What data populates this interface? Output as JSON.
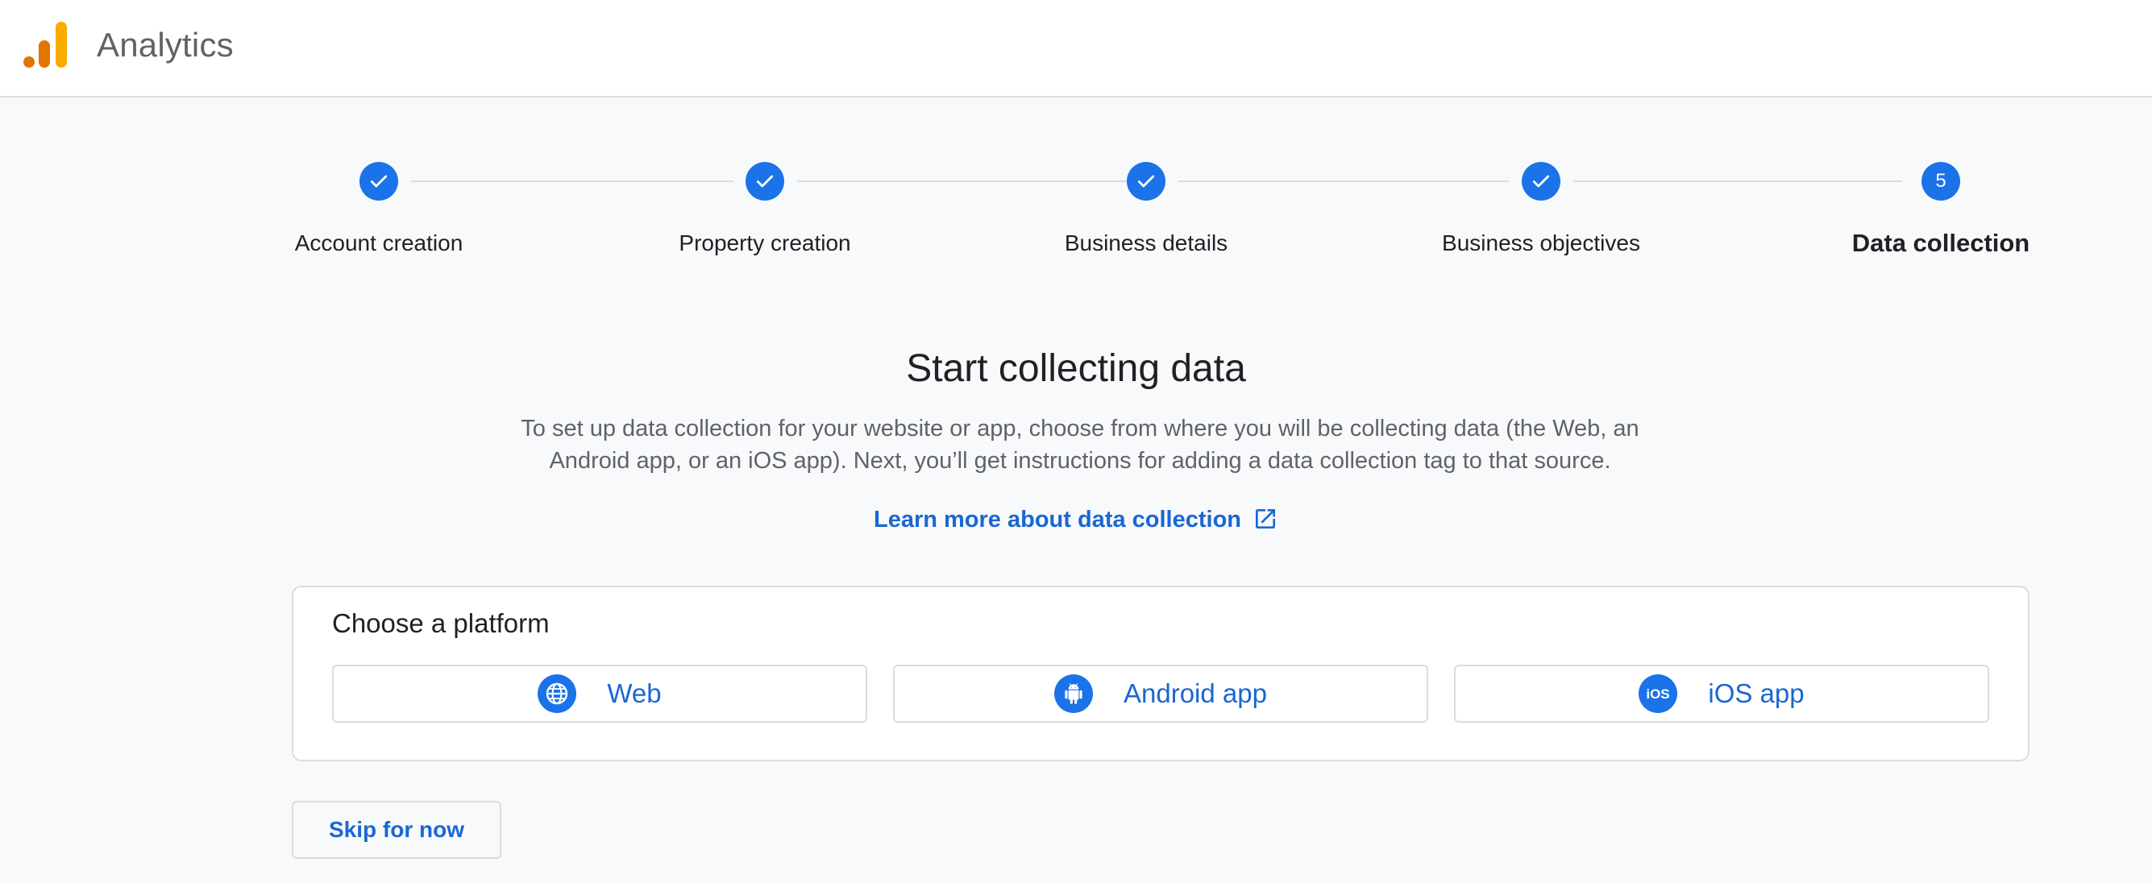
{
  "header": {
    "app_title": "Analytics",
    "logo_colors": [
      "#f9ab00",
      "#e37400"
    ]
  },
  "stepper": {
    "accent_color": "#1a73e8",
    "steps": [
      {
        "label": "Account creation",
        "state": "complete"
      },
      {
        "label": "Property creation",
        "state": "complete"
      },
      {
        "label": "Business details",
        "state": "complete"
      },
      {
        "label": "Business objectives",
        "state": "complete"
      },
      {
        "label": "Data collection",
        "state": "current",
        "number": "5"
      }
    ]
  },
  "main": {
    "heading": "Start collecting data",
    "description": "To set up data collection for your website or app, choose from where you will be collecting data (the Web, an Android app, or an iOS app). Next, you’ll get instructions for adding a data collection tag to that source.",
    "learn_more": "Learn more about data collection",
    "learn_more_icon": "open-in-new-icon"
  },
  "platform_card": {
    "title": "Choose a platform",
    "platforms": [
      {
        "label": "Web",
        "icon": "globe-icon"
      },
      {
        "label": "Android app",
        "icon": "android-icon"
      },
      {
        "label": "iOS app",
        "icon": "ios-icon"
      }
    ]
  },
  "actions": {
    "skip_label": "Skip for now"
  }
}
